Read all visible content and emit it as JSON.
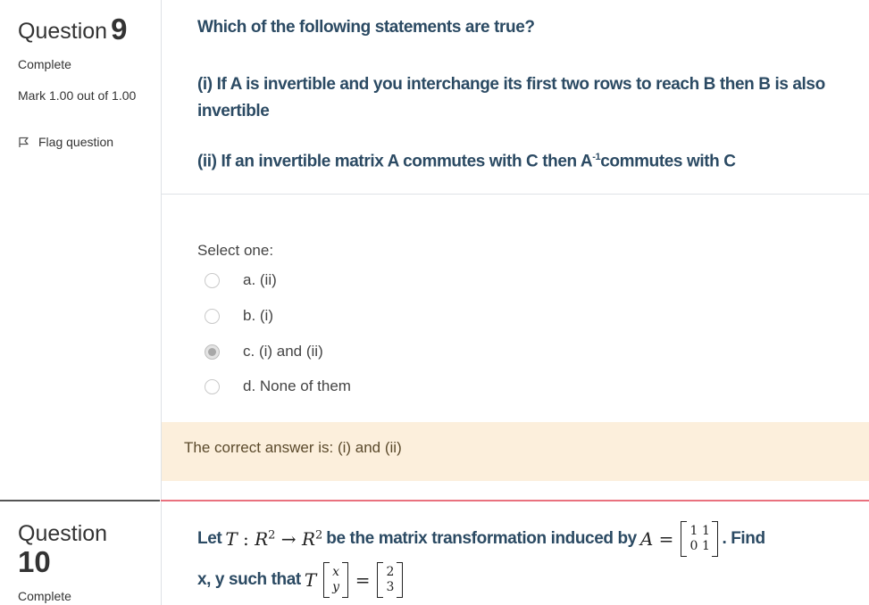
{
  "question9": {
    "label": "Question",
    "number": "9",
    "state": "Complete",
    "grade": "Mark 1.00 out of 1.00",
    "flag_label": "Flag question",
    "text_line1": "Which of the following statements are true?",
    "text_line2": "(i) If A is invertible and you interchange its first two rows to reach B then B is also invertible",
    "text_line3_pre": "(ii) If an invertible matrix A commutes with C then A",
    "text_line3_sup": "-1",
    "text_line3_post": "commutes with C",
    "prompt": "Select one:",
    "options": [
      {
        "label": "a. (ii)",
        "selected": false
      },
      {
        "label": "b. (i)",
        "selected": false
      },
      {
        "label": "c. (i) and (ii)",
        "selected": true
      },
      {
        "label": "d. None of them",
        "selected": false
      }
    ],
    "feedback": "The correct answer is: (i) and (ii)"
  },
  "question10": {
    "label": "Question",
    "number": "10",
    "state": "Complete",
    "text_let": "Let",
    "math_T": "T",
    "math_R": "R",
    "math_exp": "2",
    "text_mid": "be the matrix transformation induced by",
    "math_A": "A",
    "matrix_A": [
      "1",
      "1",
      "0",
      "1"
    ],
    "text_find": ". Find",
    "text_line2": "x, y such that",
    "vector_xy": [
      "x",
      "y"
    ],
    "vector_result": [
      "2",
      "3"
    ]
  },
  "colors": {
    "question_text": "#2b4a63",
    "feedback_bg": "#fcefdc",
    "divider_accent": "#e9717e"
  }
}
